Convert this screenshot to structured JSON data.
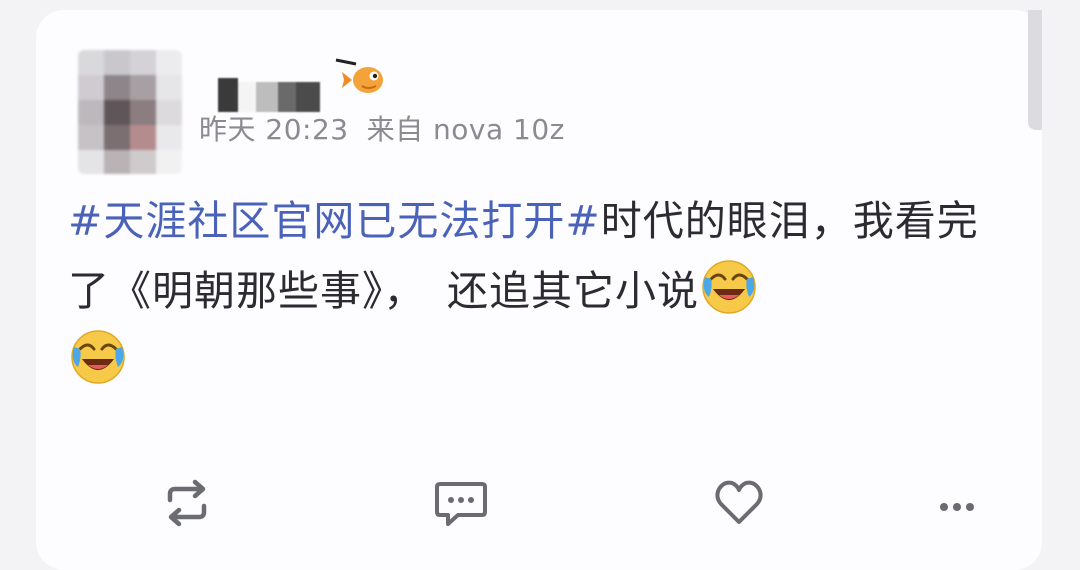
{
  "post": {
    "meta": {
      "time": "昨天 20:23",
      "source": "来自 nova 10z"
    },
    "content": {
      "hashtag": "#天涯社区官网已无法打开#",
      "text_part1": "时代的眼泪，我看完了《明朝那些事》，",
      "text_part2": "还追其它小说"
    },
    "emojis": [
      "laugh-cry-emoji",
      "laugh-cry-emoji"
    ]
  },
  "actions": [
    {
      "name": "repost",
      "icon": "repost-icon"
    },
    {
      "name": "comment",
      "icon": "comment-icon"
    },
    {
      "name": "like",
      "icon": "heart-icon"
    },
    {
      "name": "more",
      "icon": "more-icon"
    }
  ],
  "colors": {
    "hashtag": "#4a63b8",
    "text": "#2b2b30",
    "meta": "#8a8a90",
    "icon": "#6b6b72",
    "card": "#fdfdff",
    "background": "#f3f3f5"
  }
}
